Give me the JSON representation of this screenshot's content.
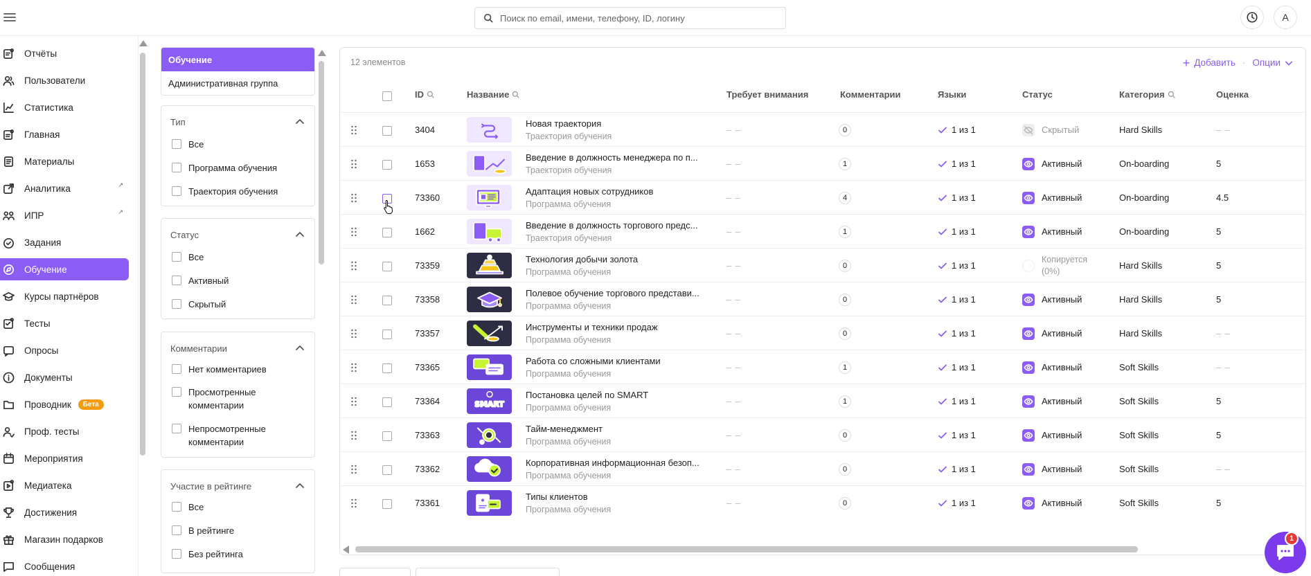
{
  "header": {
    "search_placeholder": "Поиск по email, имени, телефону, ID, логину",
    "avatar_letter": "A"
  },
  "sidebar": {
    "items": [
      {
        "label": "Отчёты",
        "icon": "report-icon"
      },
      {
        "label": "Пользователи",
        "icon": "users-icon"
      },
      {
        "label": "Статистика",
        "icon": "chart-line-icon"
      },
      {
        "label": "Главная",
        "icon": "home-icon"
      },
      {
        "label": "Материалы",
        "icon": "materials-icon"
      },
      {
        "label": "Аналитика",
        "icon": "analytics-icon",
        "external": true
      },
      {
        "label": "ИПР",
        "icon": "idp-icon",
        "external": true
      },
      {
        "label": "Задания",
        "icon": "tasks-icon"
      },
      {
        "label": "Обучение",
        "icon": "learning-icon",
        "active": true
      },
      {
        "label": "Курсы партнёров",
        "icon": "partner-courses-icon"
      },
      {
        "label": "Тесты",
        "icon": "tests-icon"
      },
      {
        "label": "Опросы",
        "icon": "surveys-icon"
      },
      {
        "label": "Документы",
        "icon": "documents-icon"
      },
      {
        "label": "Проводник",
        "icon": "folder-icon",
        "badge": "Бета"
      },
      {
        "label": "Проф. тесты",
        "icon": "prof-tests-icon"
      },
      {
        "label": "Мероприятия",
        "icon": "calendar-icon"
      },
      {
        "label": "Медиатека",
        "icon": "media-icon"
      },
      {
        "label": "Достижения",
        "icon": "trophy-icon"
      },
      {
        "label": "Магазин подарков",
        "icon": "gift-icon"
      },
      {
        "label": "Сообщения",
        "icon": "messages-icon"
      }
    ]
  },
  "filters": {
    "tabs": [
      "Обучение",
      "Административная группа"
    ],
    "groups": [
      {
        "title": "Тип",
        "options": [
          "Все",
          "Программа обучения",
          "Траектория обучения"
        ]
      },
      {
        "title": "Статус",
        "options": [
          "Все",
          "Активный",
          "Скрытый"
        ]
      },
      {
        "title": "Комментарии",
        "options": [
          "Нет комментариев",
          "Просмотренные комментарии",
          "Непросмотренные комментарии"
        ]
      },
      {
        "title": "Участие в рейтинге",
        "options": [
          "Все",
          "В рейтинге",
          "Без рейтинга"
        ]
      }
    ]
  },
  "table": {
    "count": "12 элементов",
    "add_label": "Добавить",
    "options_label": "Опции",
    "columns": {
      "id": "ID",
      "name": "Название",
      "attention": "Требует внимания",
      "comments": "Комментарии",
      "languages": "Языки",
      "status": "Статус",
      "category": "Категория",
      "score": "Оценка"
    },
    "empty": "– –",
    "rows": [
      {
        "id": "3404",
        "title": "Новая траектория",
        "subtitle": "Траектория обучения",
        "attention": "– –",
        "comments": "0",
        "lang": "1 из 1",
        "status": "Скрытый",
        "category": "Hard Skills",
        "score": "– –"
      },
      {
        "id": "1653",
        "title": "Введение в должность менеджера по п...",
        "subtitle": "Траектория обучения",
        "attention": "– –",
        "comments": "1",
        "lang": "1 из 1",
        "status": "Активный",
        "category": "On-boarding",
        "score": "5"
      },
      {
        "id": "73360",
        "title": "Адаптация новых сотрудников",
        "subtitle": "Программа обучения",
        "attention": "– –",
        "comments": "4",
        "lang": "1 из 1",
        "status": "Активный",
        "category": "On-boarding",
        "score": "4.5"
      },
      {
        "id": "1662",
        "title": "Введение в должность торгового предс...",
        "subtitle": "Траектория обучения",
        "attention": "– –",
        "comments": "1",
        "lang": "1 из 1",
        "status": "Активный",
        "category": "On-boarding",
        "score": "5"
      },
      {
        "id": "73359",
        "title": "Технология добычи золота",
        "subtitle": "Программа обучения",
        "attention": "– –",
        "comments": "0",
        "lang": "1 из 1",
        "status": "Копируется",
        "status2": "(0%)",
        "category": "Hard Skills",
        "score": "5"
      },
      {
        "id": "73358",
        "title": "Полевое обучение торгового представи...",
        "subtitle": "Программа обучения",
        "attention": "– –",
        "comments": "0",
        "lang": "1 из 1",
        "status": "Активный",
        "category": "Hard Skills",
        "score": "5"
      },
      {
        "id": "73357",
        "title": "Инструменты и техники продаж",
        "subtitle": "Программа обучения",
        "attention": "– –",
        "comments": "0",
        "lang": "1 из 1",
        "status": "Активный",
        "category": "Hard Skills",
        "score": "– –"
      },
      {
        "id": "73365",
        "title": "Работа со сложными клиентами",
        "subtitle": "Программа обучения",
        "attention": "– –",
        "comments": "1",
        "lang": "1 из 1",
        "status": "Активный",
        "category": "Soft Skills",
        "score": "– –"
      },
      {
        "id": "73364",
        "title": "Постановка целей по SMART",
        "subtitle": "Программа обучения",
        "attention": "– –",
        "comments": "1",
        "lang": "1 из 1",
        "status": "Активный",
        "category": "Soft Skills",
        "score": "5"
      },
      {
        "id": "73363",
        "title": "Тайм-менеджмент",
        "subtitle": "Программа обучения",
        "attention": "– –",
        "comments": "0",
        "lang": "1 из 1",
        "status": "Активный",
        "category": "Soft Skills",
        "score": "5"
      },
      {
        "id": "73362",
        "title": "Корпоративная информационная безоп...",
        "subtitle": "Программа обучения",
        "attention": "– –",
        "comments": "0",
        "lang": "1 из 1",
        "status": "Активный",
        "category": "Soft Skills",
        "score": "– –"
      },
      {
        "id": "73361",
        "title": "Типы клиентов",
        "subtitle": "Программа обучения",
        "attention": "– –",
        "comments": "0",
        "lang": "1 из 1",
        "status": "Активный",
        "category": "Soft Skills",
        "score": "5"
      }
    ]
  },
  "chat": {
    "badge": "1"
  },
  "colors": {
    "accent": "#8b5cf6",
    "badge_beta": "#f39c12",
    "notification": "#e53935"
  }
}
